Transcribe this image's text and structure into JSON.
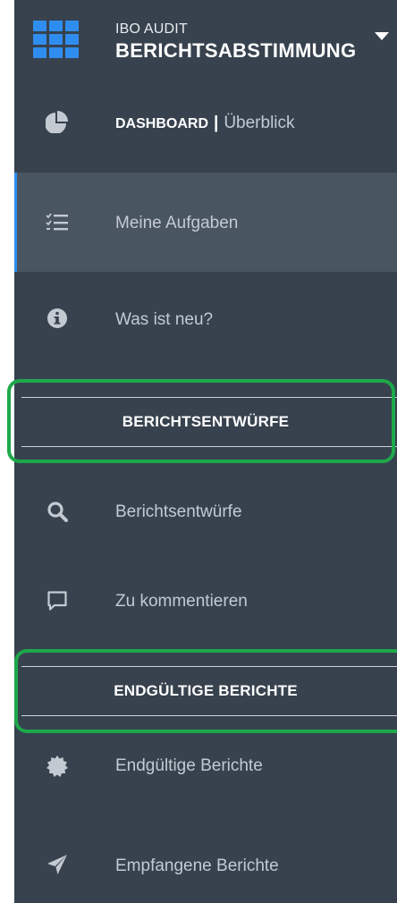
{
  "header": {
    "subtitle": "IBO AUDIT",
    "title": "BERICHTSABSTIMMUNG",
    "grid_icon": "apps-grid-icon",
    "caret_icon": "caret-down-icon"
  },
  "nav": {
    "dashboard": {
      "strong": "DASHBOARD",
      "separator": "|",
      "rest": "Überblick",
      "icon": "pie-chart-icon"
    },
    "aufgaben": {
      "label": "Meine Aufgaben",
      "icon": "task-list-icon",
      "active": true
    },
    "neu": {
      "label": "Was ist neu?",
      "icon": "info-icon"
    }
  },
  "sections": {
    "entwuerfe": {
      "title": "BERICHTSENTWÜRFE",
      "items": [
        {
          "label": "Berichtsentwürfe",
          "icon": "search-icon"
        },
        {
          "label": "Zu kommentieren",
          "icon": "comment-icon"
        }
      ]
    },
    "endgueltig": {
      "title": "ENDGÜLTIGE BERICHTE",
      "items": [
        {
          "label": "Endgültige Berichte",
          "icon": "badge-icon"
        },
        {
          "label": "Empfangene Berichte",
          "icon": "paper-plane-icon"
        }
      ]
    }
  },
  "colors": {
    "sidebar_bg": "#37424e",
    "active_bg": "#4a5562",
    "accent": "#2f8df0",
    "highlight": "#1ea84a",
    "text": "#c3cad2"
  }
}
